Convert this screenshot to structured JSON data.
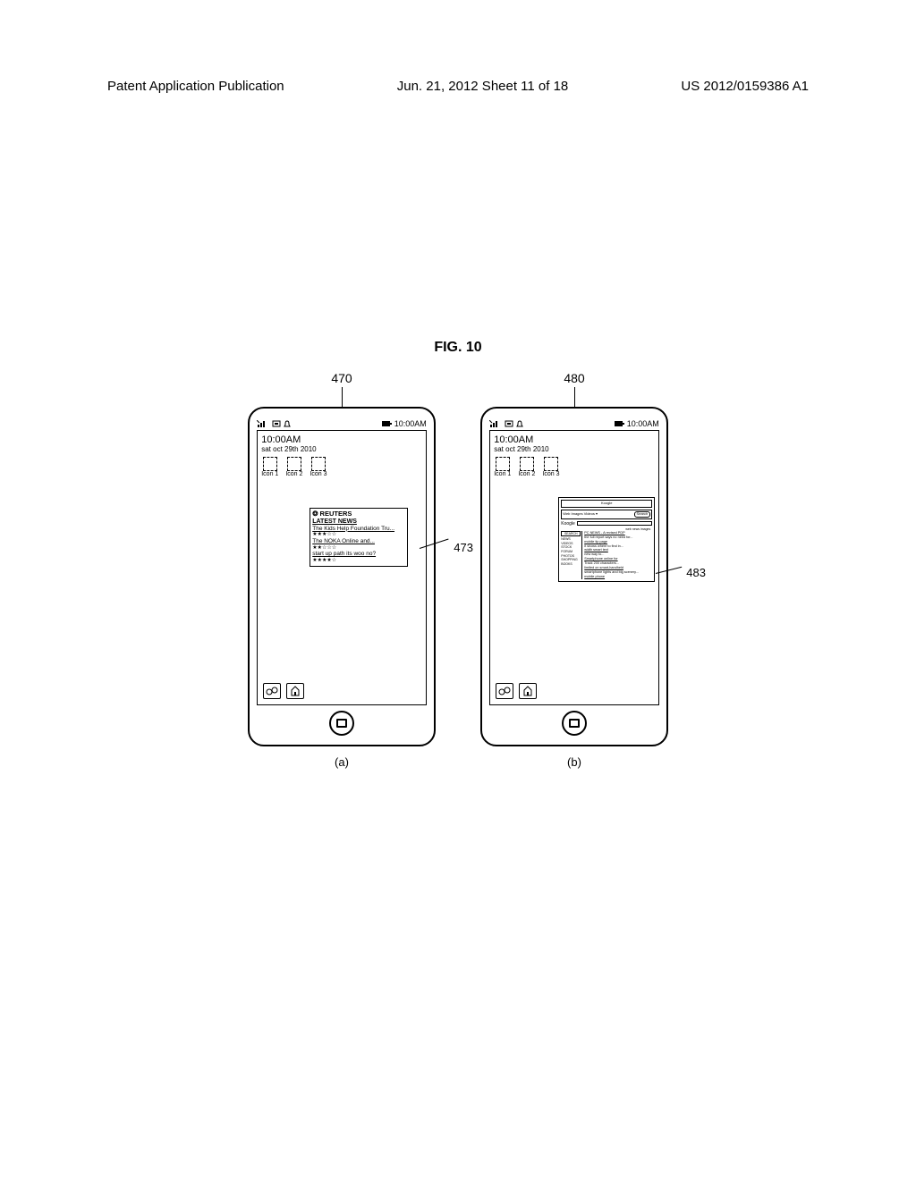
{
  "header": {
    "left": "Patent Application Publication",
    "center": "Jun. 21, 2012  Sheet 11 of 18",
    "right": "US 2012/0159386 A1"
  },
  "figure_title": "FIG. 10",
  "refs": {
    "a": "470",
    "b": "480",
    "callout_a": "473",
    "callout_b": "483"
  },
  "sub_labels": {
    "a": "(a)",
    "b": "(b)"
  },
  "status": {
    "time": "10:00AM",
    "battery_glyph": "▮"
  },
  "home": {
    "clock": "10:00AM",
    "date": "sat oct 29th 2010",
    "icons": [
      "Icon 1",
      "Icon 2",
      "Icon 3"
    ]
  },
  "widget_a": {
    "brand": "REUTERS",
    "subtitle": "LATEST NEWS",
    "items": [
      {
        "text": "The Kids Help Foundation Tru...",
        "stars": "★★★☆☆"
      },
      {
        "text": "The NOKA Online and...",
        "stars": "★★☆☆☆"
      },
      {
        "text": "start up path its woo no?",
        "stars": "★★★★☆"
      }
    ]
  },
  "widget_b": {
    "search_brand_small": "Koogle",
    "search_hint": "Web Images Videos ▾",
    "search_button": "Search",
    "brand": "Koogle",
    "tabs": "web  news  images",
    "left_col": [
      "SEARCH",
      "NEWS",
      "VIDEOS",
      "STOCK",
      "FORUM",
      "PHOTOS",
      "SHOPPING",
      "BOOKS"
    ],
    "results": [
      {
        "title": "PC NEWS - A revised PDP",
        "snip": "the full report says no need for..."
      },
      {
        "title": "mobile tip page",
        "snip": "it shows where to find in..."
      },
      {
        "title": "width smart text",
        "snip": "new way to..."
      },
      {
        "title": "Smartphone online for",
        "snip": "Track 200 characters..."
      },
      {
        "title": "limited on smart-handheld",
        "snip": "smartphone lights and big scenery..."
      },
      {
        "title": "mobile phone",
        "snip": ""
      }
    ]
  }
}
